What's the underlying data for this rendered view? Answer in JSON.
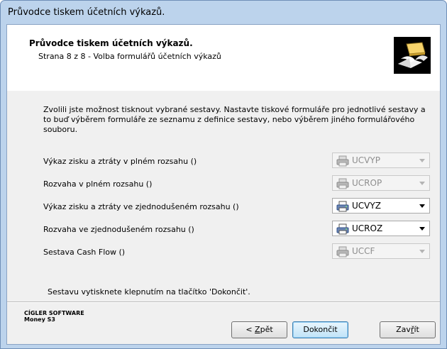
{
  "window": {
    "title": "Průvodce tiskem účetních výkazů."
  },
  "header": {
    "title": "Průvodce tiskem účetních výkazů.",
    "subtitle": "Strana 8 z 8 - Volba formulářů účetních výkazů"
  },
  "description": "Zvolili jste možnost tisknout vybrané sestavy. Nastavte tiskové formuláře pro jednotlivé sestavy a to buď výběrem formuláře ze seznamu z definice sestavy, nebo výběrem jiného formulářového souboru.",
  "rows": [
    {
      "label": "Výkaz zisku a ztráty v plném rozsahu ()",
      "value": "UCVYP",
      "enabled": false
    },
    {
      "label": "Rozvaha v plném rozsahu ()",
      "value": "UCROP",
      "enabled": false
    },
    {
      "label": "Výkaz zisku a ztráty ve zjednodušeném rozsahu ()",
      "value": "UCVYZ",
      "enabled": true
    },
    {
      "label": "Rozvaha ve zjednodušeném rozsahu ()",
      "value": "UCROZ",
      "enabled": true
    },
    {
      "label": "Sestava Cash Flow ()",
      "value": "UCCF",
      "enabled": false
    }
  ],
  "finish_hint": "Sestavu vytisknete klepnutím na tlačítko 'Dokončit'.",
  "brand": {
    "line1": "CÍGLER SOFTWARE",
    "line2": "Money S3"
  },
  "buttons": {
    "back_prefix": "< ",
    "back_underlined": "Z",
    "back_rest": "pět",
    "finish": "Dokončit",
    "close_prefix": "Zav",
    "close_underlined": "ř",
    "close_rest": "ít"
  },
  "icons": {
    "header": "open-book-icon",
    "combo": "printer-icon"
  }
}
